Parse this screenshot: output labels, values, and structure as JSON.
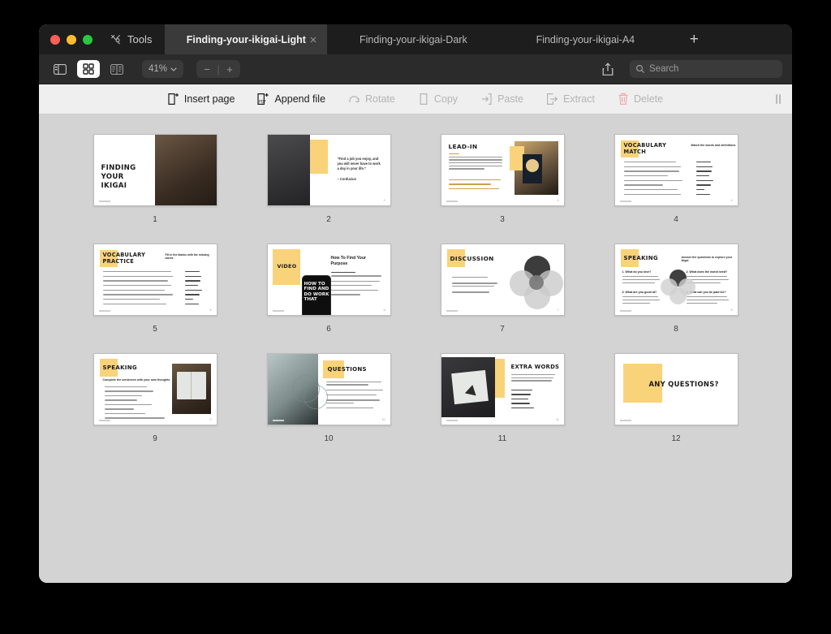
{
  "window": {
    "traffic_lights": [
      "close",
      "minimize",
      "maximize"
    ],
    "tools_label": "Tools",
    "tabs": [
      {
        "title": "Finding-your-ikigai-Light",
        "active": true,
        "closable": true
      },
      {
        "title": "Finding-your-ikigai-Dark",
        "active": false,
        "closable": false
      },
      {
        "title": "Finding-your-ikigai-A4",
        "active": false,
        "closable": false
      }
    ],
    "new_tab_label": "+"
  },
  "toolbar": {
    "sidebar_icon": "sidebar-icon",
    "grid_icon": "grid-view-icon",
    "split_icon": "split-view-icon",
    "zoom_value": "41%",
    "zoom_chevron": "chevron-down-icon",
    "zoom_out_label": "−",
    "zoom_separator": "|",
    "zoom_in_label": "+",
    "share_icon": "share-icon",
    "search_icon": "search-icon",
    "search_placeholder": "Search",
    "search_value": ""
  },
  "actions": [
    {
      "label": "Insert page",
      "icon": "insert-page-icon",
      "enabled": true
    },
    {
      "label": "Append file",
      "icon": "append-file-icon",
      "enabled": true
    },
    {
      "label": "Rotate",
      "icon": "rotate-icon",
      "enabled": false
    },
    {
      "label": "Copy",
      "icon": "copy-icon",
      "enabled": false
    },
    {
      "label": "Paste",
      "icon": "paste-icon",
      "enabled": false
    },
    {
      "label": "Extract",
      "icon": "extract-icon",
      "enabled": false
    },
    {
      "label": "Delete",
      "icon": "trash-icon",
      "enabled": false
    }
  ],
  "accent_yellow": "#f9d37a",
  "pages": [
    {
      "number": "1",
      "title": "FINDING YOUR IKIGAI",
      "layout": "title-photo-right"
    },
    {
      "number": "2",
      "title": "",
      "quote": "“Find a job you enjoy, and you will never have to work a day in your life.”",
      "attribution": "– Confucius",
      "layout": "photo-left-quote-right"
    },
    {
      "number": "3",
      "title": "LEAD-IN",
      "layout": "text-left-photo-right"
    },
    {
      "number": "4",
      "title": "VOCABULARY MATCH",
      "subtitle": "Match the words and definitions",
      "layout": "two-column-list"
    },
    {
      "number": "5",
      "title": "VOCABULARY PRACTICE",
      "subtitle": "Fill in the blanks with the missing words",
      "layout": "two-column-list"
    },
    {
      "number": "6",
      "title": "VIDEO",
      "heading": "How To Find Your Purpose",
      "phone_text": "HOW TO FIND AND DO WORK THAT",
      "layout": "video-phone"
    },
    {
      "number": "7",
      "title": "DISCUSSION",
      "layout": "bullets-venn"
    },
    {
      "number": "8",
      "title": "SPEAKING",
      "subtitle": "Answer the questions to explore your ikigai",
      "questions": [
        "1. What do you love?",
        "2. What does the world need?",
        "3. What are you good at?",
        "4. What can you be paid for?"
      ],
      "layout": "four-quadrant-venn"
    },
    {
      "number": "9",
      "title": "SPEAKING",
      "subtitle": "Complete the sentences with your own thoughts",
      "layout": "list-photo-right"
    },
    {
      "number": "10",
      "title": "QUESTIONS",
      "layout": "photo-left-questions"
    },
    {
      "number": "11",
      "title": "EXTRA WORDS",
      "layout": "photo-left-words"
    },
    {
      "number": "12",
      "title": "ANY QUESTIONS?",
      "layout": "closing"
    }
  ]
}
